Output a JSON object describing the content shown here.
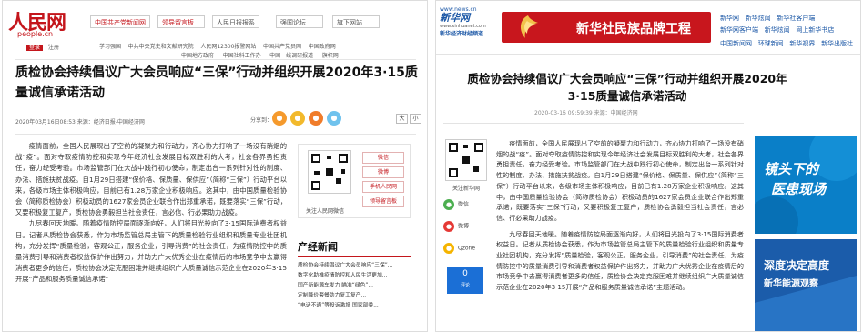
{
  "left": {
    "logo_text": "人民网",
    "logo_domain": "people.cn",
    "nav_selects": [
      "中国共产党新闻网",
      "领导留言板",
      "人民日报报系",
      "强国论坛",
      "旗下网站"
    ],
    "subnav_tags": [
      "登录",
      "注册"
    ],
    "links_row1": [
      "学习强国",
      "中共中央党史和文献研究院",
      "人民网12300报警网站",
      "中国共产党员网",
      "中国政府网"
    ],
    "links_row2": [
      "中国地方政府",
      "中国社科工作办",
      "中国一线调研报道",
      "旗帜网"
    ],
    "title": "质检协会持续倡议广大会员响应“三保”行动并组织开展2020年3·15质量诚信承诺活动",
    "meta": "2020年03月16日08:53  来源：经济日报-中国经济网",
    "share_label": "分享到：",
    "share_icons": [
      {
        "name": "weixin-share-icon",
        "glyph": "●",
        "color": "#f59a2d"
      },
      {
        "name": "weibo-share-icon",
        "glyph": "●",
        "color": "#f2b92c"
      },
      {
        "name": "qzone-share-icon",
        "glyph": "●",
        "color": "#f07c2a"
      },
      {
        "name": "people-share-icon",
        "glyph": "●",
        "color": "#6fc2ed"
      }
    ],
    "font_buttons": [
      "大",
      "小"
    ],
    "body": [
      "疫情面前，全国人民展现出了空前的凝聚力和行动力，齐心协力打响了一场没有硝烟的战“疫”。面对夺取疫情防控和实现今年经济社会发展目标双胜利的大考，社会各界勇担责任，奋力经受考验。市场监管部门在大战中践行初心使命，制定出台一系列针对性的制度、办法、措施扶贫战疫。自1月29日搭建“保价格、保质量、保供应”（简称“三保”）行动平台以来，各级市场主体积极响应，目前已有1.28万家企业积极响应。这其中，由中国质量检验协会（简称质检协会）积极动员的1627家会员企业联合作出郑重承诺，既要落实“三保”行动，又要积极复工复产，质检协会勇毅担当社会责任，言必信、行必果助力战疫。",
      "九尽春回天地暖。随着疫情防控局面逐渐向好，人们将目光投向了3·15国际消费者权益日。记者从质检协会获悉，作为市场监管总局主管下的质量检验行业组织和质量专业社团机构，充分发挥“质量检验，客观公正，服务企业，引导消费”的社会责任，为疫情防控中的质量消费引导和消费者权益保护作出努力，并助力广大优秀企业在疫情后的市场竞争中去赢得消费者更多的信任，质检协会决定克服困难并继续组织广大质量诚信示范企业在2020年3·15开展“产品和服务质量诚信承诺”"
    ],
    "qr_label": "关注人民网微信",
    "qr_buttons": [
      "微信",
      "微博",
      "手机人民网",
      "领导留言板"
    ],
    "news_heading": "产经新闻",
    "news": [
      "质检协会持续倡议广大会员响应“三保”...",
      "数字化助推疫情防控和人民生活更加...",
      "国产新能源车发力 瞄准“绿色”...",
      "定制降价套餐助力复工复产...",
      "“电话不通”等投诉激增 国家部委..."
    ]
  },
  "right": {
    "logo_domain": "www.news.cn",
    "logo_brand": "新华网",
    "logo_sub": "www.xinhuanet.com",
    "logo_channel": "新华经济财经频道",
    "banner_text": "新华社民族品牌工程",
    "topnav_row1": [
      "新华网",
      "新华炫闻",
      "新华社客户端"
    ],
    "topnav_row2": [
      "新华网客户端",
      "新华炫闻",
      "网上新华书店"
    ],
    "navline": [
      "中国新闻网",
      "环球新闻",
      "新华视界",
      "新华出版社"
    ],
    "title": "质检协会持续倡议广大会员响应“三保”行动并组织开展2020年3·15质量诚信承诺活动",
    "meta": "2020-03-16 09:59:39   来源：中国经济网",
    "qr_label": "关注新华网",
    "social": [
      {
        "label": "微信",
        "name": "weixin-icon",
        "color": "#4caf50"
      },
      {
        "label": "微博",
        "name": "weibo-icon",
        "color": "#e53935"
      },
      {
        "label": "Qzone",
        "name": "qzone-icon",
        "color": "#f5b400"
      }
    ],
    "comment_count": "0",
    "comment_unit": "评论",
    "body": [
      "疫情面前，全国人民展现出了空前的凝聚力和行动力，齐心协力打响了一场没有硝烟的战“疫”。面对夺取疫情防控和实现今年经济社会发展目标双胜利的大考，社会各界勇担责任，奋力经受考验。市场监管部门在大战中践行初心使命，制定出台一系列针对性的制度、办法、措施扶贫战疫。自1月29日搭建“保价格、保质量、保供应”（简称“三保”）行动平台以来，各级市场主体积极响应，目前已有1.28万家企业积极响应。这其中，由中国质量检验协会（简称质检协会）积极动员的1627家会员企业联合作出郑重承诺，既要落实“三保”行动，又要积极复工复产，质检协会勇毅担当社会责任，言必信、行必果助力战疫。",
      "九尽春回天地暖。随着疫情防控局面逐渐向好，人们将目光投向了3·15国际消费者权益日。记者从质检协会获悉，作为市场监管总局主管下的质量检验行业组织和质量专业社团机构，充分发挥“质量检验，客观公正，服务企业，引导消费”的社会责任，为疫情防控中的质量消费引导和消费者权益保护作出努力，并助力广大优秀企业在疫情后的市场竞争中去赢得消费者更多的信任，质检协会决定克服困难并继续组织广大质量诚信示范企业在2020年3·15开展“产品和服务质量诚信承诺”主题活动。"
    ],
    "ad1_text": [
      "镜头下的",
      "医患现场"
    ],
    "ad2_text": [
      "深度决定高度",
      "新华能源观察"
    ]
  }
}
